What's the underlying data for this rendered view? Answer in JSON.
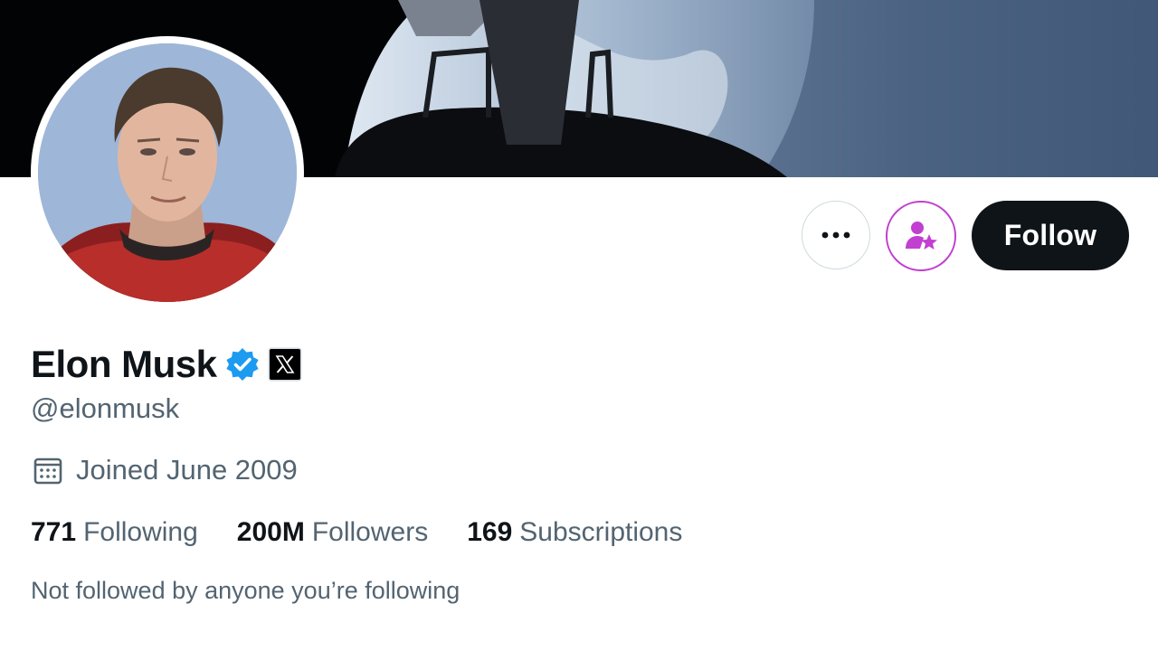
{
  "profile": {
    "display_name": "Elon Musk",
    "handle": "@elonmusk",
    "joined": "Joined June 2009",
    "verified_color": "#1d9bf0",
    "affiliate_badge": "x-logo-icon"
  },
  "actions": {
    "more_icon": "more-horizontal-icon",
    "subscribe_icon": "subscribe-person-star-icon",
    "subscribe_color": "#c13fd1",
    "follow_label": "Follow"
  },
  "stats": [
    {
      "value": "771",
      "label": "Following"
    },
    {
      "value": "200M",
      "label": "Followers"
    },
    {
      "value": "169",
      "label": "Subscriptions"
    }
  ],
  "footer": {
    "not_followed": "Not followed by anyone you’re following"
  }
}
